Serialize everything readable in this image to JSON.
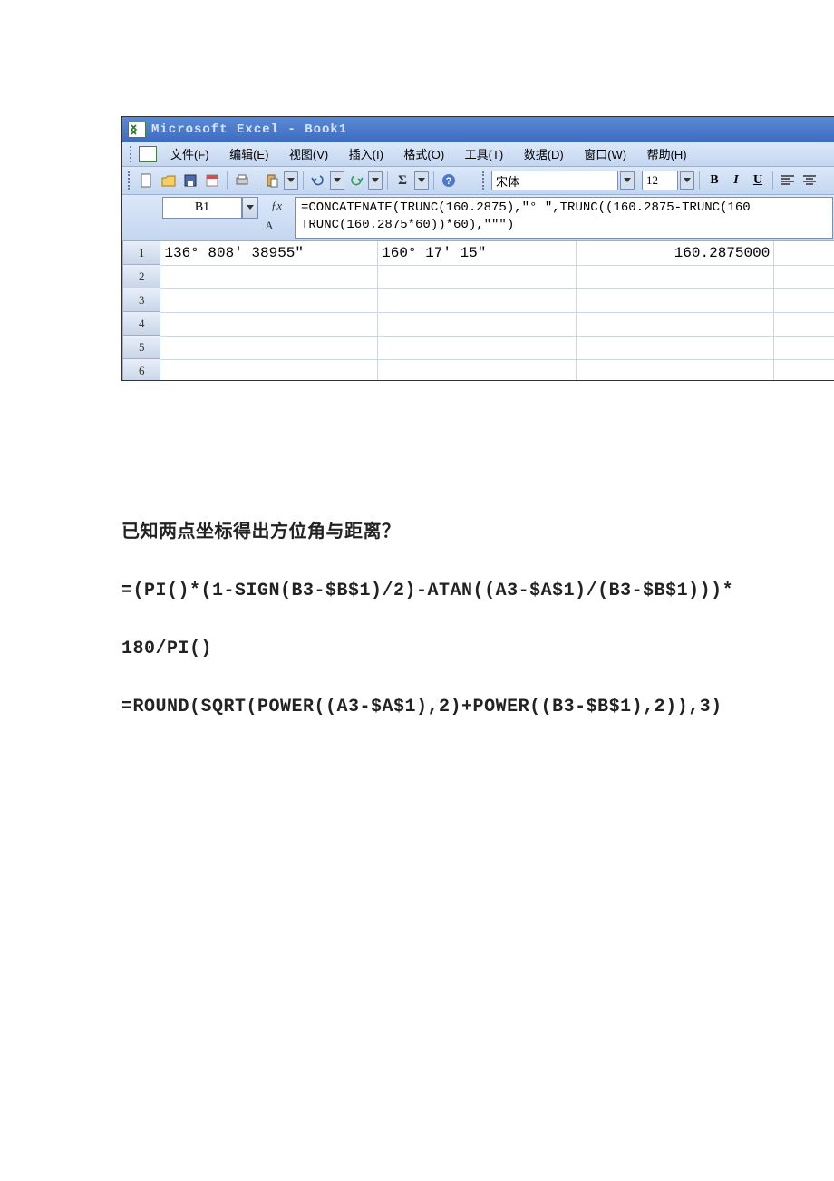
{
  "window_title": "Microsoft Excel - Book1",
  "menus": {
    "file": "文件(F)",
    "edit": "编辑(E)",
    "view": "视图(V)",
    "insert": "插入(I)",
    "format": "格式(O)",
    "tools": "工具(T)",
    "data": "数据(D)",
    "window": "窗口(W)",
    "help": "帮助(H)"
  },
  "font_name": "宋体",
  "font_size": "12",
  "name_box": "B1",
  "formula_line1": "=CONCATENATE(TRUNC(160.2875),\"° \",TRUNC((160.2875-TRUNC(160",
  "formula_line2": "TRUNC(160.2875*60))*60),\"″\")",
  "colheads": {
    "A": "A"
  },
  "rows": [
    "1",
    "2",
    "3",
    "4",
    "5",
    "6"
  ],
  "cells": {
    "A1": "136° 808′ 38955″",
    "B1": "160° 17′ 15″",
    "C1": "160.2875000"
  },
  "doc": {
    "h": "已知两点坐标得出方位角与距离？",
    "l1": "=(PI()*(1-SIGN(B3-$B$1)/2)-ATAN((A3-$A$1)/(B3-$B$1)))*",
    "l2": "180/PI()",
    "l3": "=ROUND(SQRT(POWER((A3-$A$1),2)+POWER((B3-$B$1),2)),3)"
  }
}
